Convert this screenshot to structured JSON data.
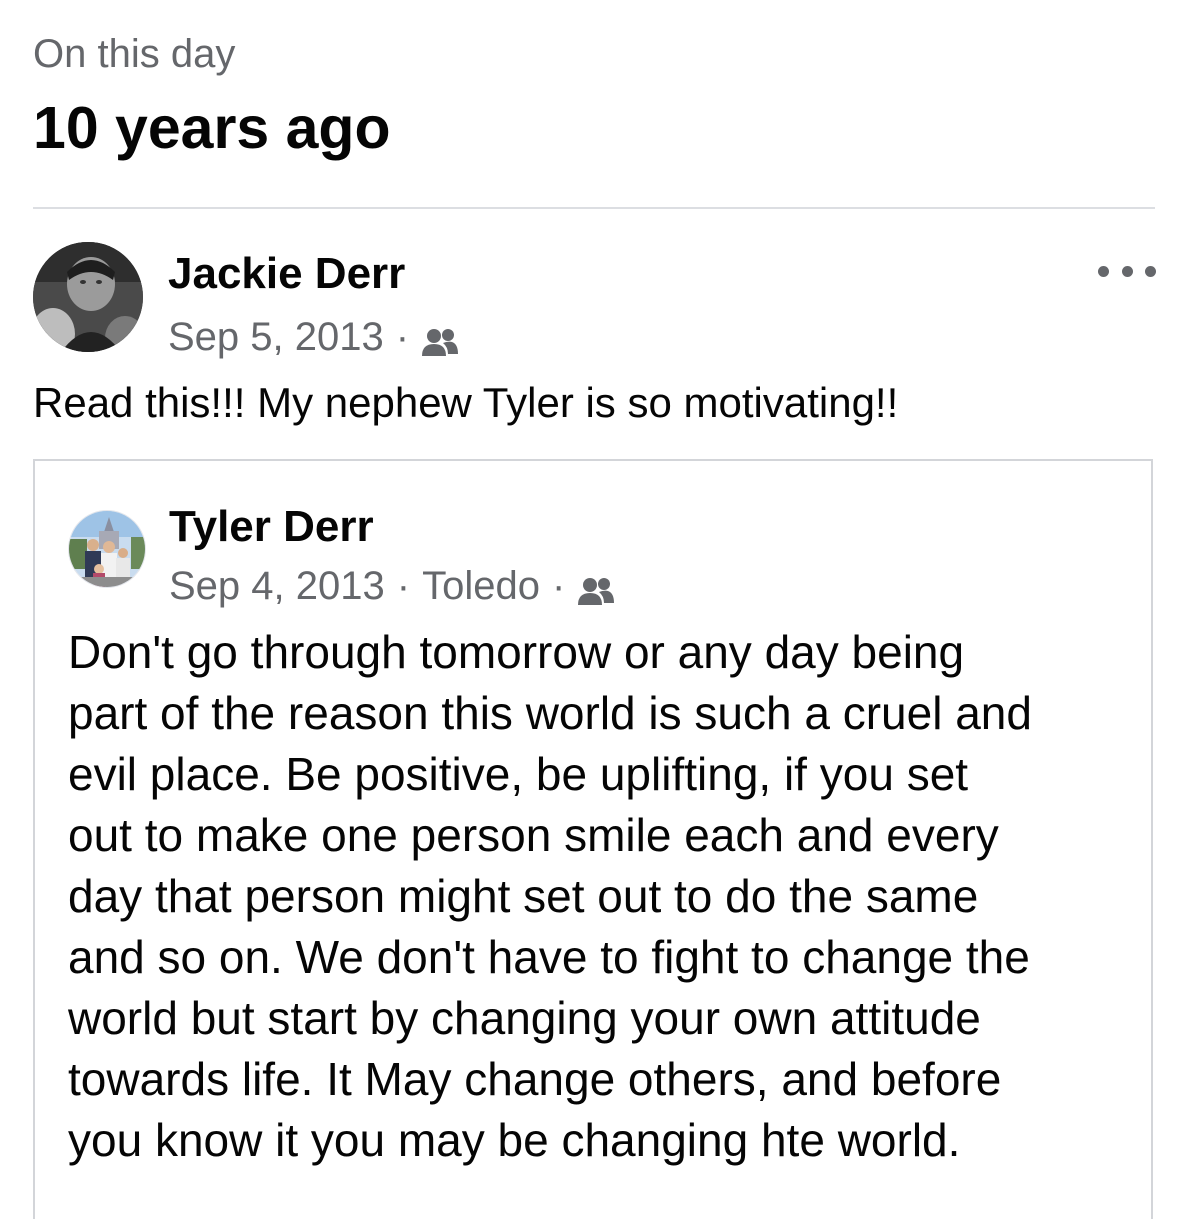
{
  "memory_header": {
    "subtitle": "On this day",
    "title": "10 years ago"
  },
  "post": {
    "author": "Jackie Derr",
    "date": "Sep 5, 2013",
    "separator": "·",
    "audience_icon": "friends-icon",
    "more_icon": "more-options-icon",
    "text": "Read this!!! My nephew Tyler is so motivating!!"
  },
  "shared_post": {
    "author": "Tyler Derr",
    "date": "Sep 4, 2013",
    "separator": "·",
    "location": "Toledo",
    "audience_icon": "friends-icon",
    "body_lines": [
      "Don't go through tomorrow or any day being",
      "part of the reason this world is such a cruel and",
      "evil place. Be positive, be uplifting, if you set",
      "out to make one person smile each and every",
      "day that person might set out to do the same",
      "and so on. We don't have to fight to change the",
      "world but start by changing your own attitude",
      "towards life. It May change others, and before",
      "you know it you may be changing hte world."
    ]
  },
  "colors": {
    "primary_text": "#050505",
    "secondary_text": "#65676b",
    "divider": "#dcdee2",
    "card_border": "#d3d5d9"
  }
}
